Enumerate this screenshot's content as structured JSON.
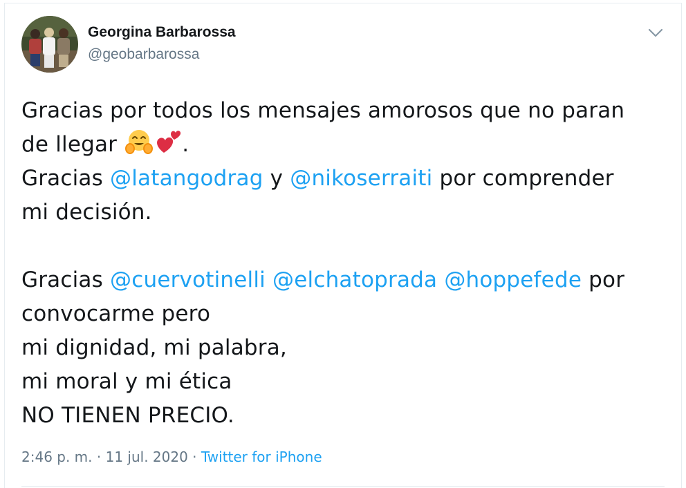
{
  "tweet": {
    "display_name": "Georgina Barbarossa",
    "handle": "@geobarbarossa",
    "line1": "Gracias por todos los mensajes amorosos que no paran",
    "line2_prefix": "de llegar",
    "line2_suffix": ".",
    "line3_prefix": "Gracias ",
    "mention_latangodrag": "@latangodrag",
    "line3_middle": " y ",
    "mention_nikoserraiti": "@nikoserraiti",
    "line3_suffix": " por comprender",
    "line4": "mi decisión.",
    "line6_prefix": "Gracias ",
    "mention_cuervotinelli": "@cuervotinelli",
    "space1": " ",
    "mention_elchatoprada": "@elchatoprada",
    "space2": " ",
    "mention_hoppefede": "@hoppefede",
    "line6_suffix": " por",
    "line7": "convocarme pero",
    "line8": "mi dignidad, mi palabra,",
    "line9": "mi moral y mi ética",
    "line10": "NO TIENEN PRECIO.",
    "emojis": [
      "hugging-face-emoji",
      "two-hearts-emoji"
    ]
  },
  "meta": {
    "timestamp": "2:46 p. m. · 11 jul. 2020 · ",
    "source": "Twitter for iPhone"
  },
  "colors": {
    "link": "#1da1f2",
    "secondary_text": "#657786",
    "primary_text": "#14171a",
    "border": "#e6ecf0"
  }
}
